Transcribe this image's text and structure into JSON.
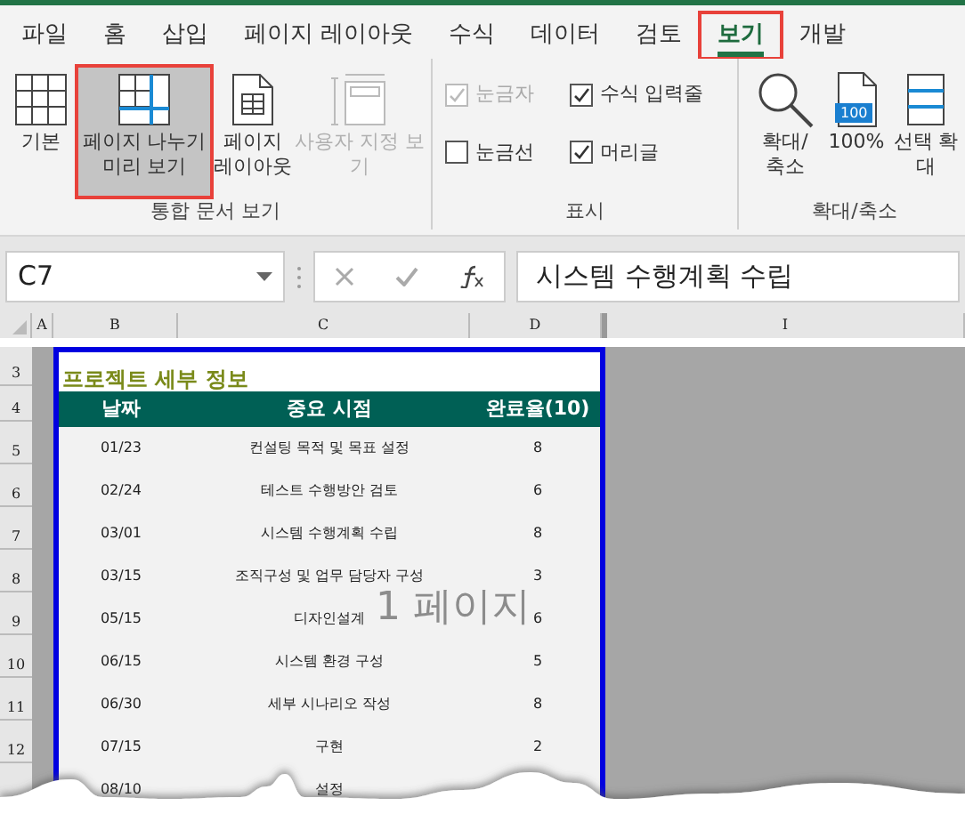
{
  "tabs": [
    {
      "label": "파일",
      "selected": false,
      "highlighted": false
    },
    {
      "label": "홈",
      "selected": false,
      "highlighted": false
    },
    {
      "label": "삽입",
      "selected": false,
      "highlighted": false
    },
    {
      "label": "페이지 레이아웃",
      "selected": false,
      "highlighted": false
    },
    {
      "label": "수식",
      "selected": false,
      "highlighted": false
    },
    {
      "label": "데이터",
      "selected": false,
      "highlighted": false
    },
    {
      "label": "검토",
      "selected": false,
      "highlighted": false
    },
    {
      "label": "보기",
      "selected": true,
      "highlighted": true
    },
    {
      "label": "개발",
      "selected": false,
      "highlighted": false
    }
  ],
  "ribbon": {
    "groups": [
      {
        "kind": "views",
        "label": "통합 문서 보기",
        "buttons": [
          {
            "label": "기본",
            "selected": false,
            "disabled": false,
            "highlighted": false
          },
          {
            "label": "페이지 나누기 미리 보기",
            "selected": true,
            "disabled": false,
            "highlighted": true
          },
          {
            "label": "페이지 레이아웃",
            "selected": false,
            "disabled": false,
            "highlighted": false
          },
          {
            "label": "사용자 지정 보기",
            "selected": false,
            "disabled": true,
            "highlighted": false
          }
        ]
      },
      {
        "kind": "checks",
        "label": "표시",
        "checks": [
          {
            "label": "눈금자",
            "checked": true,
            "disabled": true
          },
          {
            "label": "수식 입력줄",
            "checked": true,
            "disabled": false
          },
          {
            "label": "눈금선",
            "checked": false,
            "disabled": false
          },
          {
            "label": "머리글",
            "checked": true,
            "disabled": false
          }
        ]
      },
      {
        "kind": "zoom",
        "label": "확대/축소",
        "buttons": [
          {
            "label": "확대/ 축소",
            "selected": false,
            "disabled": false,
            "highlighted": false
          },
          {
            "label": "100%",
            "selected": false,
            "disabled": false,
            "highlighted": false,
            "badge": "100"
          },
          {
            "label": "선택 확대",
            "selected": false,
            "disabled": false,
            "highlighted": false
          }
        ]
      }
    ]
  },
  "formula_bar": {
    "name_box": "C7",
    "formula": "시스템 수행계획 수립"
  },
  "column_headers": [
    "A",
    "B",
    "C",
    "D",
    "I"
  ],
  "sheet": {
    "title": "프로젝트 세부 정보",
    "columns": [
      "날짜",
      "중요 시점",
      "완료율(10)"
    ],
    "row_numbers": [
      "3",
      "4",
      "5",
      "6",
      "7",
      "8",
      "9",
      "10",
      "11",
      "12"
    ],
    "rows": [
      [
        "01/23",
        "컨설팅 목적 및 목표 설정",
        "8"
      ],
      [
        "02/24",
        "테스트 수행방안 검토",
        "6"
      ],
      [
        "03/01",
        "시스템 수행계획 수립",
        "8"
      ],
      [
        "03/15",
        "조직구성 및 업무 담당자 구성",
        "3"
      ],
      [
        "05/15",
        "디자인설계",
        "6"
      ],
      [
        "06/15",
        "시스템 환경 구성",
        "5"
      ],
      [
        "06/30",
        "세부 시나리오 작성",
        "8"
      ],
      [
        "07/15",
        "구현",
        "2"
      ],
      [
        "08/10",
        "설정"
      ]
    ],
    "page_label": "1 페이지"
  }
}
